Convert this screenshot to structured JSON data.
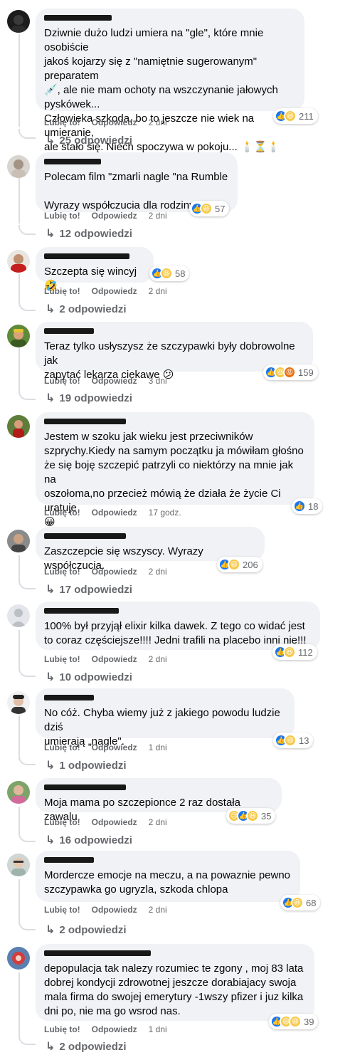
{
  "labels": {
    "like": "Lubię to!",
    "reply": "Odpowiedz"
  },
  "comments": [
    {
      "text": "Dziwnie dużo ludzi umiera na \"gle\", które mnie osobiście\njakoś kojarzy się z \"namiętnie sugerowanym\" preparatem\n💉, ale nie mam ochoty na wszczynanie jałowych\npyskówek...\nCzłowieka szkoda, bo to jeszcze nie wiek na umieranie,\nale stało się. Niech spoczywa w pokoju... 🕯️⏳🕯️",
      "reaction_count": "211",
      "time": "2 dni",
      "replies": "25 odpowiedzi",
      "reactions": [
        "like",
        "haha"
      ]
    },
    {
      "text": "Polecam film \"zmarli nagle \"na Rumble\n\nWyrazy współczucia dla rodziny",
      "reaction_count": "57",
      "time": "2 dni",
      "replies": "12 odpowiedzi",
      "reactions": [
        "like",
        "haha"
      ]
    },
    {
      "text": "Szczepta się wincyj🤣",
      "reaction_count": "58",
      "time": "2 dni",
      "replies": "2 odpowiedzi",
      "reactions": [
        "like",
        "haha"
      ]
    },
    {
      "text": "Teraz tylko usłyszysz że szczypawki były dobrowolne jak\nzapytać lekarza ciekawe 😕",
      "reaction_count": "159",
      "time": "3 dni",
      "replies": "19 odpowiedzi",
      "reactions": [
        "like",
        "haha",
        "angry"
      ]
    },
    {
      "text": "Jestem w szoku jak wieku jest przeciwników\nszprychy.Kiedy na samym początku ja mówiłam głośno\nże się boję szczepić patrzyli co niektórzy na mnie jak na\noszołoma,no przecież mówią że działa że życie Ci uratuje\n😀",
      "reaction_count": "18",
      "time": "17 godz.",
      "replies": "",
      "reactions": [
        "like"
      ]
    },
    {
      "text": "Zaszczepcie się wszyscy. Wyrazy współczucia.",
      "reaction_count": "206",
      "time": "2 dni",
      "replies": "17 odpowiedzi",
      "reactions": [
        "like",
        "haha"
      ]
    },
    {
      "text": "100% był przyjął elixir kilka dawek. Z tego co widać jest\nto coraz częściejsze!!!! Jedni trafili na placebo inni nie!!!",
      "reaction_count": "112",
      "time": "2 dni",
      "replies": "10 odpowiedzi",
      "reactions": [
        "like",
        "haha"
      ]
    },
    {
      "text": "No cóż. Chyba wiemy już z jakiego powodu ludzie dziś\numierają „nagle\".",
      "reaction_count": "13",
      "time": "1 dni",
      "replies": "1 odpowiedzi",
      "reactions": [
        "like",
        "haha"
      ]
    },
    {
      "text": "Moja mama po szczepionce 2 raz dostała zawalu.",
      "reaction_count": "35",
      "time": "2 dni",
      "replies": "16 odpowiedzi",
      "reactions": [
        "sad",
        "like",
        "haha"
      ]
    },
    {
      "text": "Mordercze emocje na meczu, a na powaznie pewno\nszczypawka go ugryzla, szkoda chlopa",
      "reaction_count": "68",
      "time": "2 dni",
      "replies": "2 odpowiedzi",
      "reactions": [
        "like",
        "haha"
      ]
    },
    {
      "text": "depopulacja tak nalezy rozumiec te zgony , moj 83 lata\ndobrej kondycji zdrowotnej jeszcze dorabiajacy swoja\nmala firma do swojej emerytury -1wszy pfizer i juz kilka\ndni po, nie ma go wsrod nas.",
      "reaction_count": "39",
      "time": "1 dni",
      "replies": "2 odpowiedzi",
      "reactions": [
        "like",
        "haha",
        "haha"
      ]
    }
  ],
  "colors": {
    "like": "#1877f2",
    "haha": "#f7c949",
    "angry": "#e9710f",
    "meta_text": "#65676b",
    "bubble": "#f0f2f5"
  }
}
